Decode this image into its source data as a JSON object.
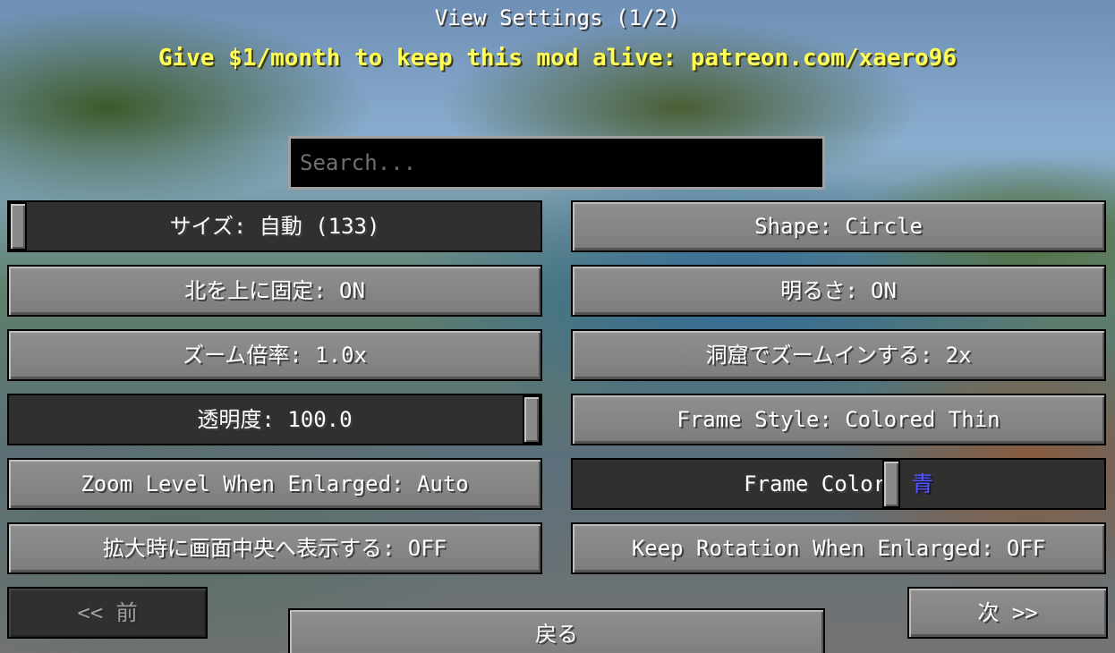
{
  "header": {
    "title": "View Settings (1/2)",
    "donate": "Give $1/month to keep this mod alive: patreon.com/xaero96"
  },
  "search": {
    "placeholder": "Search..."
  },
  "left": {
    "size_slider": {
      "label": "サイズ: 自動 (133)",
      "value_fraction": 0.0
    },
    "lock_north": "北を上に固定: ON",
    "zoom": "ズーム倍率: 1.0x",
    "opacity_slider": {
      "label": "透明度: 100.0",
      "value_fraction": 1.0
    },
    "zoom_enlarged": "Zoom Level When Enlarged: Auto",
    "center_enlarged": "拡大時に画面中央へ表示する: OFF"
  },
  "right": {
    "shape": "Shape: Circle",
    "brightness": "明るさ: ON",
    "cave_zoom": "洞窟でズームインする: 2x",
    "frame_style": "Frame Style: Colored Thin",
    "frame_color": {
      "label": "Frame Color: ",
      "value": "青",
      "value_color": "#5555ff"
    },
    "keep_rotation": "Keep Rotation When Enlarged: OFF"
  },
  "nav": {
    "prev": "<< 前",
    "back": "戻る",
    "next": "次 >>"
  }
}
